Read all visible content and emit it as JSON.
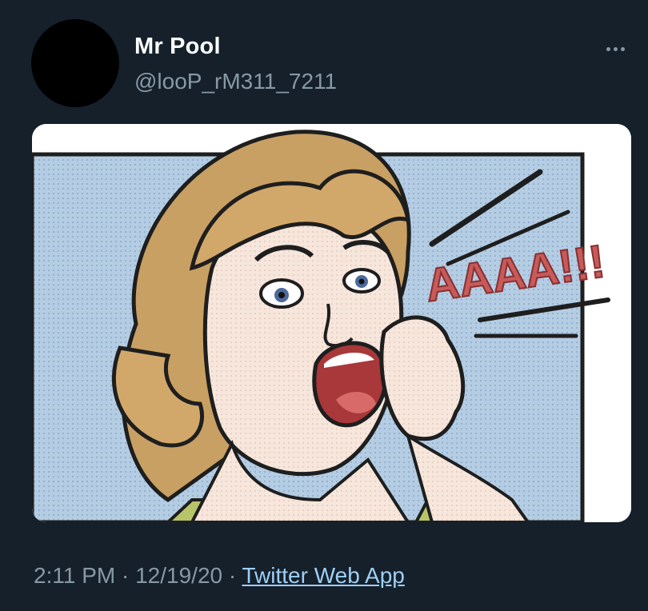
{
  "tweet": {
    "author": {
      "display_name": "Mr Pool",
      "handle": "@looP_rM311_7211",
      "avatar_icon": "avatar-placeholder"
    },
    "more_icon": "ellipsis-icon",
    "media": {
      "caption_text": "AAAA!!!"
    },
    "meta": {
      "time": "2:11 PM",
      "separator": "·",
      "date": "12/19/20",
      "source": "Twitter Web App"
    }
  },
  "colors": {
    "background": "#15202b",
    "secondary_text": "#8899a6",
    "link": "#9ecff5",
    "comic_sky": "#a9c6e0",
    "comic_text_red": "#c75a5a"
  }
}
